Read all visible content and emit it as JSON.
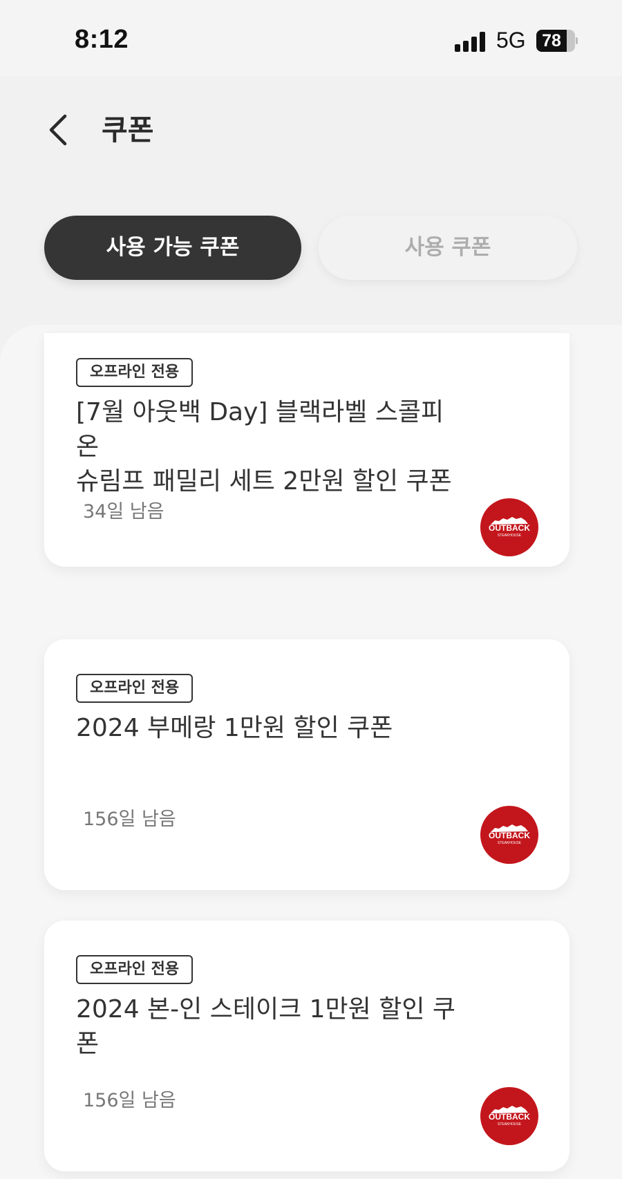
{
  "status_bar": {
    "time": "8:12",
    "network": "5G",
    "battery": "78",
    "battery_level": 0.78
  },
  "header": {
    "title": "쿠폰",
    "back_icon": "chevron-left-icon"
  },
  "tabs": [
    {
      "label": "사용 가능 쿠폰",
      "active": true
    },
    {
      "label": "사용 쿠폰",
      "active": false
    }
  ],
  "coupons": [
    {
      "badge": "오프라인 전용",
      "title_line1": "[7월 아웃백 Day] 블랙라벨 스콜피온",
      "title_line2": "슈림프 패밀리 세트 2만원 할인 쿠폰",
      "days_left": "34일 남음",
      "brand_logo": "outback-logo"
    },
    {
      "badge": "오프라인 전용",
      "title_line1": "2024 부메랑 1만원 할인 쿠폰",
      "title_line2": "",
      "days_left": "156일 남음",
      "brand_logo": "outback-logo"
    },
    {
      "badge": "오프라인 전용",
      "title_line1": "2024 본-인 스테이크 1만원 할인 쿠",
      "title_line2": "폰",
      "days_left": "156일 남음",
      "brand_logo": "outback-logo"
    }
  ],
  "brand": {
    "name": "OUTBACK",
    "sub": "STEAKHOUSE",
    "color": "#c3161c"
  },
  "colors": {
    "tab_active_bg": "#353535",
    "tab_inactive_text": "#adadad",
    "page_bg": "#f1f1f1"
  }
}
